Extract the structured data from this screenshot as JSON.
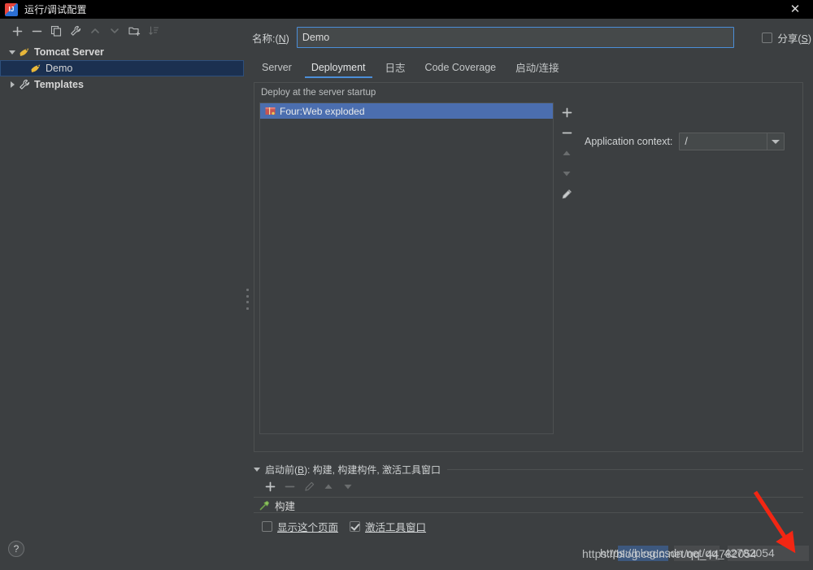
{
  "window": {
    "title": "运行/调试配置",
    "app_icon": "intellij-idea-icon",
    "close_label": "✕"
  },
  "tree_toolbar": {
    "buttons": [
      {
        "name": "add-configuration-button",
        "icon": "plus-icon",
        "label": "+",
        "enabled": true
      },
      {
        "name": "remove-configuration-button",
        "icon": "minus-icon",
        "label": "−",
        "enabled": true
      },
      {
        "name": "copy-configuration-button",
        "icon": "copy-icon",
        "label": "⧉",
        "enabled": true
      },
      {
        "name": "edit-templates-button",
        "icon": "wrench-icon",
        "label": "🔧",
        "enabled": true
      },
      {
        "name": "move-up-button",
        "icon": "chevron-up-icon",
        "label": "▲",
        "enabled": false
      },
      {
        "name": "move-down-button",
        "icon": "chevron-down-icon",
        "label": "▼",
        "enabled": false
      },
      {
        "name": "move-into-folder-button",
        "icon": "folder-add-icon",
        "label": "🗀",
        "enabled": true
      },
      {
        "name": "sort-configurations-button",
        "icon": "sort-icon",
        "label": "↓↑",
        "enabled": false
      }
    ]
  },
  "tree": {
    "items": [
      {
        "label": "Tomcat Server",
        "icon": "tomcat-icon",
        "expander": "expanded",
        "indent": 0,
        "selected": false,
        "bold": true
      },
      {
        "label": "Demo",
        "icon": "tomcat-icon",
        "expander": "none",
        "indent": 1,
        "selected": true,
        "bold": false
      },
      {
        "label": "Templates",
        "icon": "wrench-icon",
        "expander": "collapsed",
        "indent": 0,
        "selected": false,
        "bold": true
      }
    ]
  },
  "name_field": {
    "label": "名称:(N)",
    "label_plain": "名称:(",
    "mnemonic": "N",
    "label_tail": ")",
    "value": "Demo",
    "placeholder": ""
  },
  "share": {
    "label_plain": "分享(",
    "mnemonic": "S",
    "label_tail": ")",
    "checked": false
  },
  "tabs": [
    {
      "label": "Server",
      "active": false
    },
    {
      "label": "Deployment",
      "active": true
    },
    {
      "label": "日志",
      "active": false
    },
    {
      "label": "Code Coverage",
      "active": false
    },
    {
      "label": "启动/连接",
      "active": false
    }
  ],
  "deployment": {
    "group_title": "Deploy at the server startup",
    "artifacts": [
      {
        "label": "Four:Web exploded",
        "icon": "artifact-icon",
        "selected": true
      }
    ],
    "side_buttons": [
      {
        "name": "add-artifact-button",
        "icon": "plus-icon",
        "label": "+",
        "enabled": true
      },
      {
        "name": "remove-artifact-button",
        "icon": "minus-icon",
        "label": "−",
        "enabled": true
      },
      {
        "name": "move-artifact-up-button",
        "icon": "chevron-up-icon",
        "label": "▲",
        "enabled": false
      },
      {
        "name": "move-artifact-down-button",
        "icon": "chevron-down-icon",
        "label": "▼",
        "enabled": false
      },
      {
        "name": "edit-artifact-button",
        "icon": "pencil-icon",
        "label": "✎",
        "enabled": true
      }
    ],
    "application_context": {
      "label": "Application context:",
      "value": "/"
    }
  },
  "before_launch": {
    "title_plain": "启动前(",
    "mnemonic": "B",
    "title_tail": "): 构建, 构建构件, 激活工具窗口",
    "toolbar": [
      {
        "name": "add-task-button",
        "icon": "plus-icon",
        "label": "+",
        "enabled": true
      },
      {
        "name": "remove-task-button",
        "icon": "minus-icon",
        "label": "−",
        "enabled": false
      },
      {
        "name": "edit-task-button",
        "icon": "pencil-icon",
        "label": "✎",
        "enabled": false
      },
      {
        "name": "task-move-up-button",
        "icon": "chevron-up-icon",
        "label": "▲",
        "enabled": false
      },
      {
        "name": "task-move-down-button",
        "icon": "chevron-down-icon",
        "label": "▼",
        "enabled": false
      }
    ],
    "tasks": [
      {
        "label": "构建",
        "icon": "hammer-icon"
      }
    ],
    "checkboxes": [
      {
        "name": "show-this-page-checkbox",
        "label": "显示这个页面",
        "checked": false
      },
      {
        "name": "activate-tool-window-checkbox",
        "label": "激活工具窗口",
        "checked": true
      }
    ]
  },
  "bottom_bar": {
    "help_label": "?"
  },
  "watermark": {
    "line_a": "https://blog.csdn.net/qq_44782054",
    "line_b": "https://blog.csdn.net/qq_42782054"
  },
  "colors": {
    "window_bg": "#3c3f41",
    "titlebar_bg": "#000000",
    "accent": "#4b8ed8",
    "selection_blue": "#4b6eaf",
    "tree_selection": "#1b3050",
    "text": "#d6d6d6",
    "border": "#4d5051",
    "annotation_red": "#f22613"
  }
}
